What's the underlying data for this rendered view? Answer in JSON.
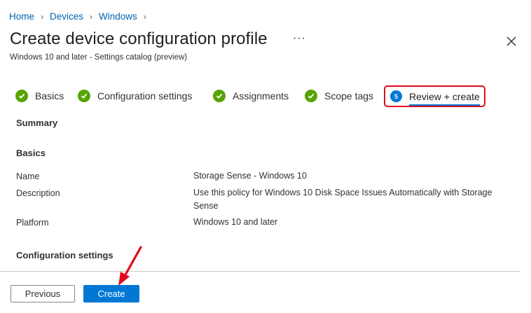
{
  "breadcrumb": [
    "Home",
    "Devices",
    "Windows"
  ],
  "page": {
    "title": "Create device configuration profile",
    "more_label": "···",
    "subtitle": "Windows 10 and later - Settings catalog (preview)"
  },
  "steps": [
    {
      "label": "Basics",
      "status": "complete"
    },
    {
      "label": "Configuration settings",
      "status": "complete"
    },
    {
      "label": "Assignments",
      "status": "complete"
    },
    {
      "label": "Scope tags",
      "status": "complete"
    },
    {
      "label": "Review + create",
      "status": "current",
      "number": "5"
    }
  ],
  "summary": {
    "summary_label": "Summary",
    "basics_label": "Basics",
    "fields": [
      {
        "key": "Name",
        "value": "Storage Sense - Windows 10"
      },
      {
        "key": "Description",
        "value": "Use this policy for Windows 10 Disk Space Issues Automatically with Storage Sense"
      },
      {
        "key": "Platform",
        "value": "Windows 10 and later"
      }
    ],
    "config_label": "Configuration settings"
  },
  "footer": {
    "previous_label": "Previous",
    "create_label": "Create"
  },
  "colors": {
    "accent": "#0078d4",
    "success": "#57a300",
    "highlight": "#e00b1c"
  }
}
